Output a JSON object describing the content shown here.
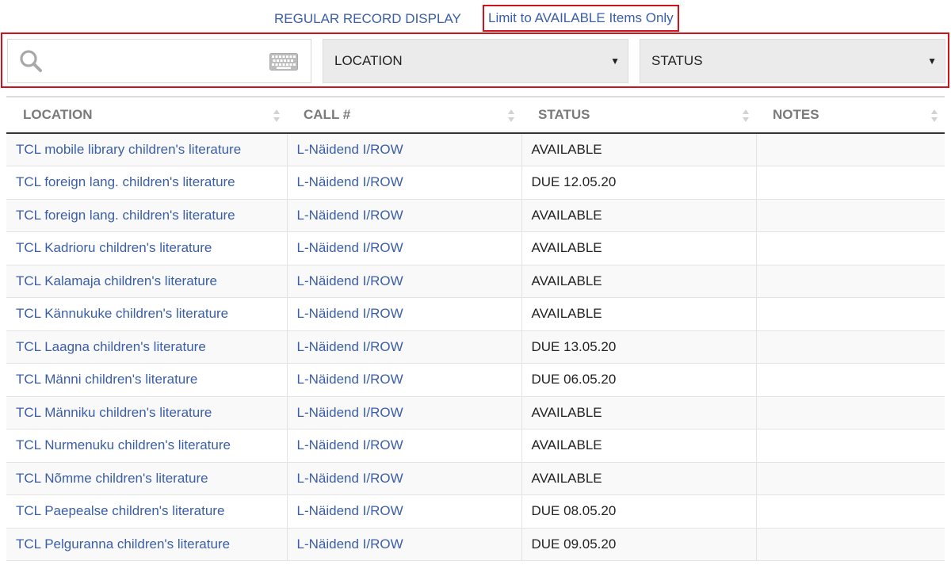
{
  "top_links": {
    "regular_record_display": "REGULAR RECORD DISPLAY",
    "limit_available": "Limit to AVAILABLE Items Only"
  },
  "filters": {
    "search_placeholder": "",
    "location_select": "LOCATION",
    "status_select": "STATUS"
  },
  "table": {
    "headers": {
      "location": "LOCATION",
      "call": "CALL #",
      "status": "STATUS",
      "notes": "NOTES"
    },
    "rows": [
      {
        "location": "TCL mobile library children's literature",
        "call": "L-Näidend I/ROW",
        "status": "AVAILABLE",
        "notes": ""
      },
      {
        "location": "TCL foreign lang. children's literature",
        "call": "L-Näidend I/ROW",
        "status": "DUE 12.05.20",
        "notes": ""
      },
      {
        "location": "TCL foreign lang. children's literature",
        "call": "L-Näidend I/ROW",
        "status": "AVAILABLE",
        "notes": ""
      },
      {
        "location": "TCL Kadrioru children's literature",
        "call": "L-Näidend I/ROW",
        "status": "AVAILABLE",
        "notes": ""
      },
      {
        "location": "TCL Kalamaja children's literature",
        "call": "L-Näidend I/ROW",
        "status": "AVAILABLE",
        "notes": ""
      },
      {
        "location": "TCL Kännukuke children's literature",
        "call": "L-Näidend I/ROW",
        "status": "AVAILABLE",
        "notes": ""
      },
      {
        "location": "TCL Laagna children's literature",
        "call": "L-Näidend I/ROW",
        "status": "DUE 13.05.20",
        "notes": ""
      },
      {
        "location": "TCL Männi children's literature",
        "call": "L-Näidend I/ROW",
        "status": "DUE 06.05.20",
        "notes": ""
      },
      {
        "location": "TCL Männiku children's literature",
        "call": "L-Näidend I/ROW",
        "status": "AVAILABLE",
        "notes": ""
      },
      {
        "location": "TCL Nurmenuku children's literature",
        "call": "L-Näidend I/ROW",
        "status": "AVAILABLE",
        "notes": ""
      },
      {
        "location": "TCL Nõmme children's literature",
        "call": "L-Näidend I/ROW",
        "status": "AVAILABLE",
        "notes": ""
      },
      {
        "location": "TCL Paepealse children's literature",
        "call": "L-Näidend I/ROW",
        "status": "DUE 08.05.20",
        "notes": ""
      },
      {
        "location": "TCL Pelguranna children's literature",
        "call": "L-Näidend I/ROW",
        "status": "DUE 09.05.20",
        "notes": ""
      }
    ]
  },
  "colors": {
    "link": "#3a5ea8",
    "highlight_border": "#d0121b",
    "header_text": "#7a7a7a",
    "select_background": "#ebebeb"
  },
  "icons": {
    "search": "search-icon",
    "keyboard": "keyboard-icon",
    "dropdown": "chevron-down-icon",
    "sort": "sort-icon"
  }
}
